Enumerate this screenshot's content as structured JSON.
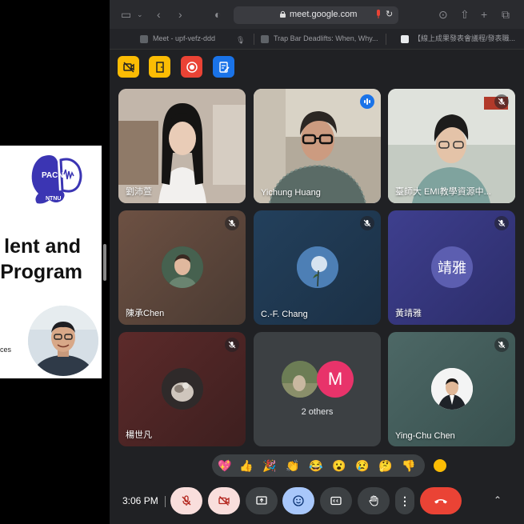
{
  "slide": {
    "logo_text_top": "PACN",
    "logo_text_bottom": "NTNU",
    "title_line1": "lent and",
    "title_line2": "Program",
    "small_text": "ces"
  },
  "browser": {
    "url": "meet.google.com",
    "tabs": [
      {
        "label": "Meet - upf-vefz-ddd",
        "color": "#5f6368"
      },
      {
        "label": "Trap Bar Deadlifts: When, Why...",
        "color": "#5f6368"
      },
      {
        "label": "【線上成果發表會議程/發表職...",
        "color": "#e8eaed"
      }
    ]
  },
  "quick_actions": [
    {
      "name": "no-video-action",
      "color": "#fbbc04"
    },
    {
      "name": "door-action",
      "color": "#fbbc04"
    },
    {
      "name": "record-action",
      "color": "#ea4335"
    },
    {
      "name": "whiteboard-action",
      "color": "#1a73e8"
    }
  ],
  "participants": [
    {
      "name": "劉沛萱",
      "muted": false
    },
    {
      "name": "Yichung Huang",
      "muted": false,
      "speaking": true
    },
    {
      "name": "臺師大 EMI教學資源中...",
      "muted": true
    },
    {
      "name": "陳承Chen",
      "muted": true
    },
    {
      "name": "C.-F. Chang",
      "muted": true
    },
    {
      "name": "黃靖雅",
      "initials": "靖雅",
      "muted": true
    },
    {
      "name": "楊世凡",
      "muted": true
    },
    {
      "name": "2 others",
      "avatar_letter": "M"
    },
    {
      "name": "Ying-Chu Chen",
      "muted": true
    }
  ],
  "reactions": [
    "💖",
    "👍",
    "🎉",
    "👏",
    "😂",
    "😮",
    "😢",
    "🤔",
    "👎"
  ],
  "controls": {
    "time": "3:06 PM",
    "buttons": [
      "mic-off",
      "camera-off",
      "present",
      "emoji",
      "captions",
      "raise-hand",
      "more",
      "end-call"
    ]
  },
  "colors": {
    "accent": "#8ab4f8",
    "danger": "#ea4335",
    "muted_bg": "#f9dedc",
    "selected_bg": "#a8c7fa"
  }
}
